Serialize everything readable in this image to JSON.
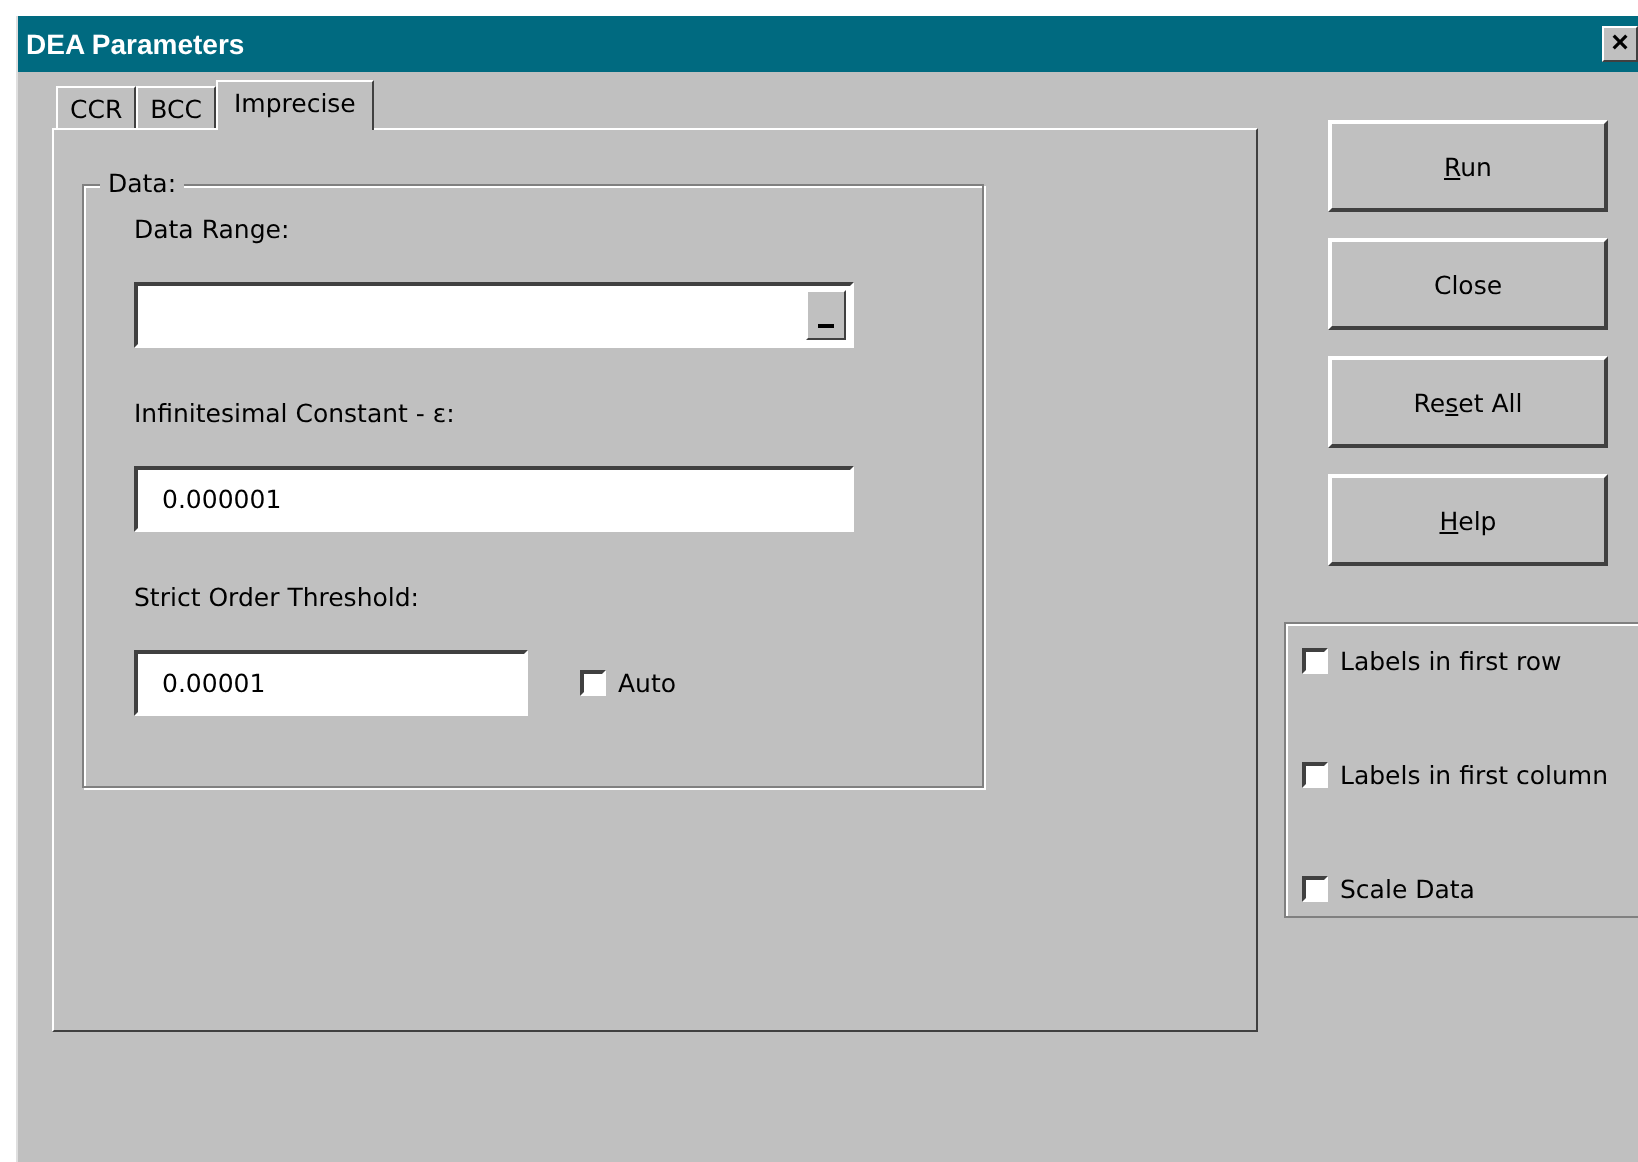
{
  "window": {
    "title": "DEA Parameters",
    "close": "×"
  },
  "tabs": [
    {
      "label": "CCR",
      "selected": false
    },
    {
      "label": "BCC",
      "selected": false
    },
    {
      "label": "Imprecise",
      "selected": true
    }
  ],
  "group": {
    "title": "Data:",
    "fields": [
      {
        "label": "Data Range:",
        "kind": "range"
      },
      {
        "label": "Infinitesimal Constant - ε:",
        "value": "0.000001",
        "kind": "text"
      },
      {
        "label": "Strict Order Threshold:",
        "value": "0.00001",
        "kind": "auto",
        "option": {
          "label": "Auto",
          "checked": false
        }
      }
    ]
  },
  "buttons": [
    {
      "mnemonic": "R",
      "after": "un"
    },
    {
      "before": "Close"
    },
    {
      "before": "Re",
      "mnemonic": "s",
      "after": "et All"
    },
    {
      "mnemonic": "H",
      "after": "elp"
    }
  ],
  "options": [
    {
      "label": "Labels in first row",
      "checked": false
    },
    {
      "label": "Labels in first column",
      "checked": false
    },
    {
      "label": "Scale Data",
      "checked": false
    }
  ]
}
